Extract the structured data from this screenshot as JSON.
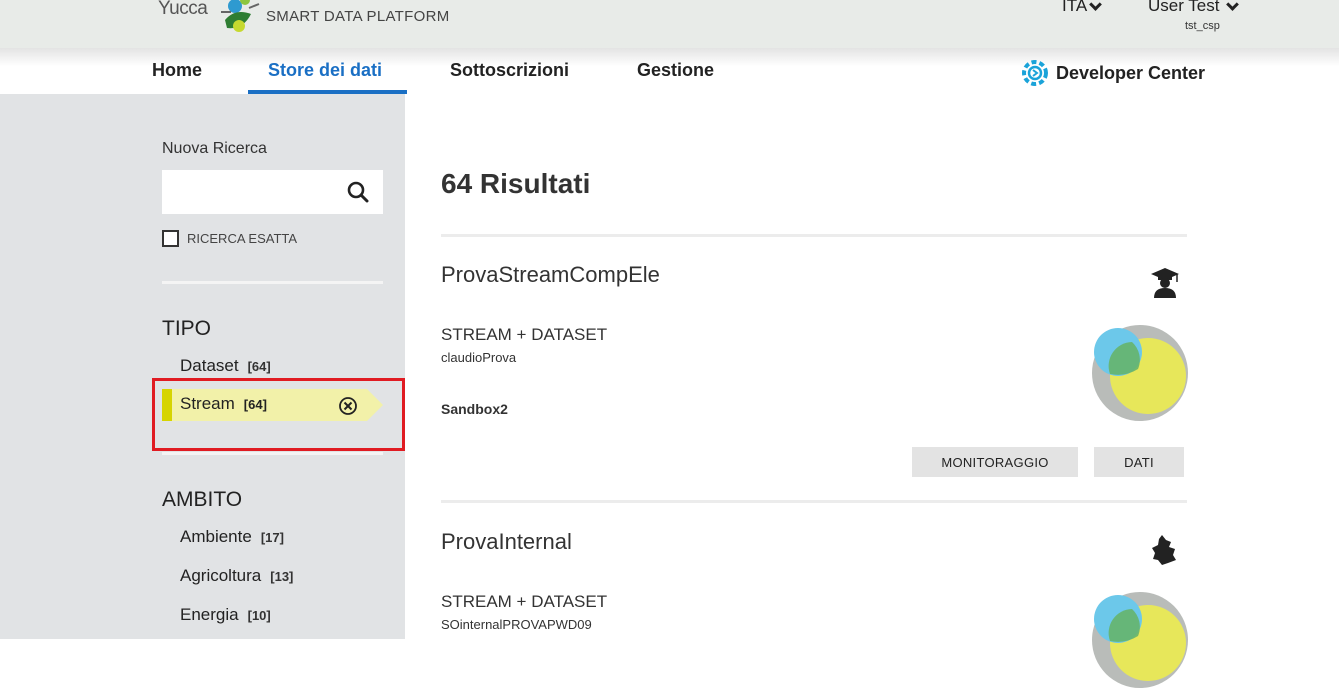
{
  "header": {
    "logo_text": "Yucca",
    "platform": "SMART DATA PLATFORM",
    "language": "ITA",
    "user_name": "User Test",
    "user_id": "tst_csp"
  },
  "nav": {
    "items": [
      {
        "label": "Home"
      },
      {
        "label": "Store dei dati"
      },
      {
        "label": "Sottoscrizioni"
      },
      {
        "label": "Gestione"
      }
    ],
    "developer_center": "Developer Center"
  },
  "sidebar": {
    "search_label": "Nuova Ricerca",
    "search_value": "",
    "exact_label": "RICERCA ESATTA",
    "type_heading": "TIPO",
    "type_facets": [
      {
        "label": "Dataset",
        "count": "[64]"
      },
      {
        "label": "Stream",
        "count": "[64]"
      }
    ],
    "scope_heading": "AMBITO",
    "scope_facets": [
      {
        "label": "Ambiente",
        "count": "[17]"
      },
      {
        "label": "Agricoltura",
        "count": "[13]"
      },
      {
        "label": "Energia",
        "count": "[10]"
      }
    ]
  },
  "main": {
    "results_title": "64 Risultati",
    "cards": [
      {
        "title": "ProvaStreamCompEle",
        "type": "STREAM + DATASET",
        "user": "claudioProva",
        "tenant": "Sandbox2",
        "icon": "graduate-icon",
        "btn_monitor": "MONITORAGGIO",
        "btn_data": "DATI"
      },
      {
        "title": "ProvaInternal",
        "type": "STREAM + DATASET",
        "user": "SOinternalPROVAPWD09",
        "icon": "region-map-icon"
      }
    ]
  },
  "colors": {
    "accent": "#1a6fc4",
    "sidebar_bg": "#e1e3e5",
    "active_facet_bg": "#f2f1a9",
    "active_facet_bar": "#d6d400",
    "highlight_border": "#e01b22"
  }
}
